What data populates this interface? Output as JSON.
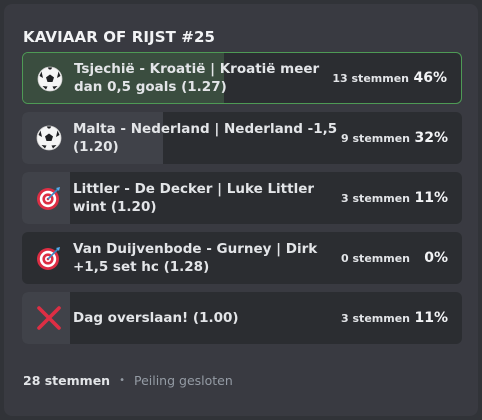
{
  "poll": {
    "title": "KAVIAAR OF RIJST #25",
    "answers": [
      {
        "label": "Tsjechië - Kroatië | Kroatië meer dan 0,5 goals (1.27)",
        "votes": "13 stemmen",
        "percent": "46%",
        "fraction": 0.46,
        "icon": "soccer-ball-icon",
        "winner": true
      },
      {
        "label": "Malta - Nederland | Nederland -1,5 (1.20)",
        "votes": "9 stemmen",
        "percent": "32%",
        "fraction": 0.32,
        "icon": "soccer-ball-icon",
        "winner": false
      },
      {
        "label": "Littler - De Decker | Luke Littler wint (1.20)",
        "votes": "3 stemmen",
        "percent": "11%",
        "fraction": 0.11,
        "icon": "dart-target-icon",
        "winner": false
      },
      {
        "label": "Van Duijvenbode - Gurney | Dirk +1,5 set hc (1.28)",
        "votes": "0 stemmen",
        "percent": "0%",
        "fraction": 0.0,
        "icon": "dart-target-icon",
        "winner": false
      },
      {
        "label": "Dag overslaan! (1.00)",
        "votes": "3 stemmen",
        "percent": "11%",
        "fraction": 0.11,
        "icon": "cross-mark-icon",
        "winner": false
      }
    ],
    "footer": {
      "total": "28 stemmen",
      "separator": "•",
      "status": "Peiling gesloten"
    },
    "colors": {
      "winner_border": "#4e9a55",
      "winner_fill": "#3a4d3f",
      "fill": "#404249",
      "background": "#393a41"
    }
  }
}
